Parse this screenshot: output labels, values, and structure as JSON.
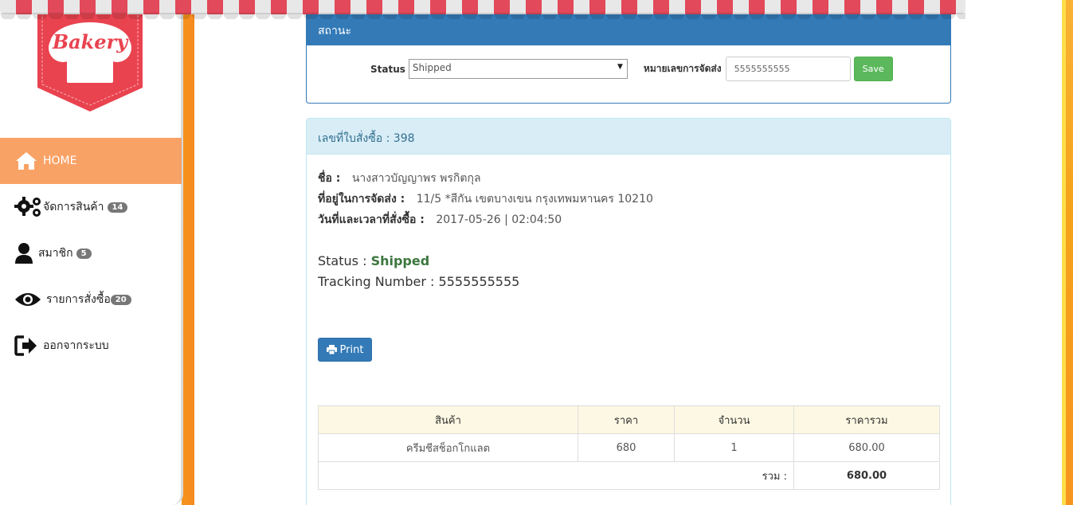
{
  "logo": {
    "text": "Bakery"
  },
  "sidebar": {
    "items": [
      {
        "label": "HOME",
        "icon": "home-icon",
        "badge": ""
      },
      {
        "label": "จัดการสินค้า",
        "icon": "gears-icon",
        "badge": "14"
      },
      {
        "label": "สมาชิก",
        "icon": "user-icon",
        "badge": "5"
      },
      {
        "label": "รายการสั่งซื้อ",
        "icon": "eye-icon",
        "badge": "20"
      },
      {
        "label": "ออกจากระบบ",
        "icon": "sign-out-icon",
        "badge": ""
      }
    ]
  },
  "status_panel": {
    "title": "สถานะ",
    "status_label": "Status",
    "status_value": "Shipped",
    "tracking_label": "หมายเลขการจัดส่ง",
    "tracking_value": "5555555555",
    "save_label": "Save"
  },
  "order_panel": {
    "title": "เลขที่ใบสั่งซื้อ : 398",
    "name_label": "ชื่อ :",
    "name_value": "นางสาวบัญญาพร พรกิตกุล",
    "address_label": "ที่อยู่ในการจัดส่ง :",
    "address_value": "11/5 *สีกัน เขตบางเขน กรุงเทพมหานคร 10210",
    "datetime_label": "วันที่และเวลาที่สั่งซื้อ :",
    "datetime_value": "2017-05-26 | 02:04:50",
    "status_text_label": "Status :",
    "status_text_value": "Shipped",
    "tracking_text_label": "Tracking Number :",
    "tracking_text_value": "5555555555",
    "print_label": "Print"
  },
  "table": {
    "headers": [
      "สินค้า",
      "ราคา",
      "จำนวน",
      "ราคารวม"
    ],
    "rows": [
      [
        "ครีมชีสช็อกโกแลต",
        "680",
        "1",
        "680.00"
      ]
    ],
    "sum_label": "รวม :",
    "sum_value": "680.00"
  },
  "colors": {
    "accent": "#337ab7",
    "active_nav": "#f9a266",
    "orange": "#f7941d",
    "success": "#5cb85c",
    "status_green": "#3c763d"
  }
}
